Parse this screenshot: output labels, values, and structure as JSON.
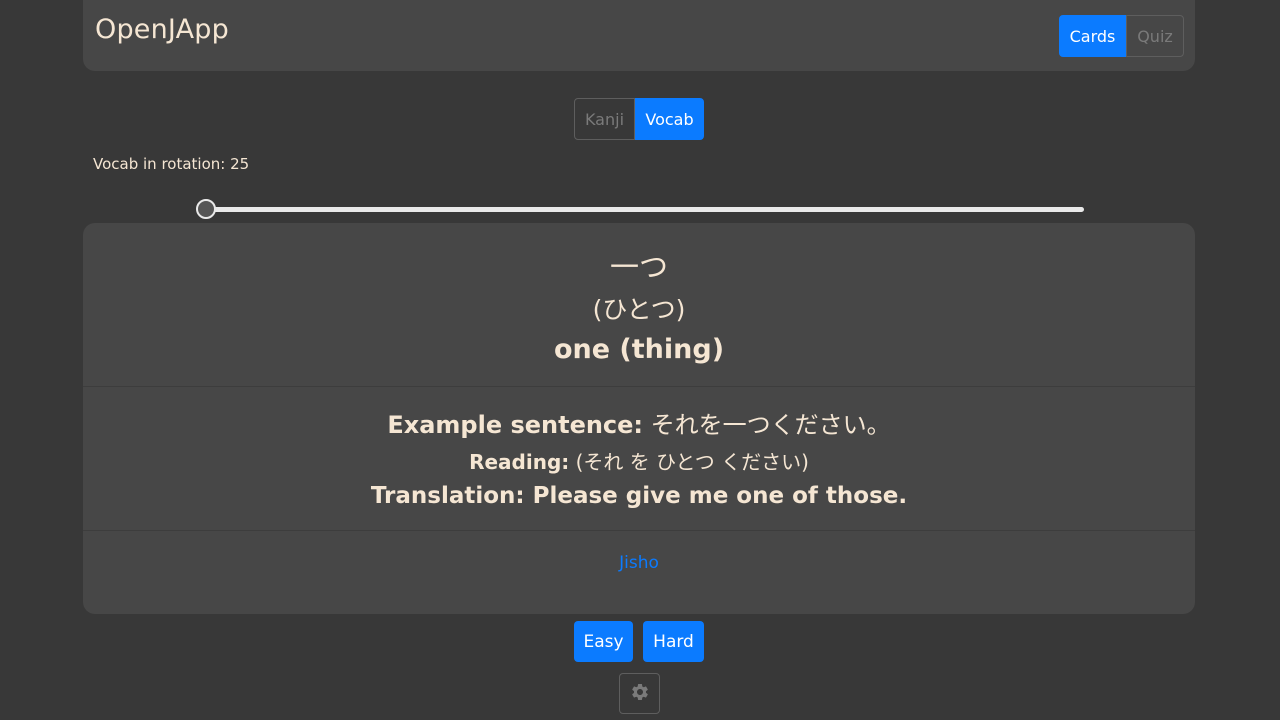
{
  "app": {
    "brand": "OpenJApp"
  },
  "nav": {
    "tabs": [
      {
        "label": "Cards",
        "active": true
      },
      {
        "label": "Quiz",
        "active": false
      }
    ]
  },
  "mode": {
    "tabs": [
      {
        "label": "Kanji",
        "active": false
      },
      {
        "label": "Vocab",
        "active": true
      }
    ]
  },
  "rotation": {
    "label": "Vocab in rotation: 25",
    "slider_fraction": 0.0
  },
  "card": {
    "word": "一つ",
    "reading": "(ひとつ)",
    "meaning": "one (thing)",
    "example_label": "Example sentence:",
    "example_text": " それを一つください。",
    "reading_label": "Reading:",
    "reading_text": " (それ を ひとつ ください)",
    "translation_label": "Translation:",
    "translation_text": " Please give me one of those.",
    "link_label": "Jisho"
  },
  "actions": {
    "easy_label": "Easy",
    "hard_label": "Hard",
    "settings_icon": "gear-icon"
  },
  "colors": {
    "accent": "#0b7bff",
    "background": "#383838",
    "panel": "#474747",
    "text": "#f5e6d3"
  }
}
